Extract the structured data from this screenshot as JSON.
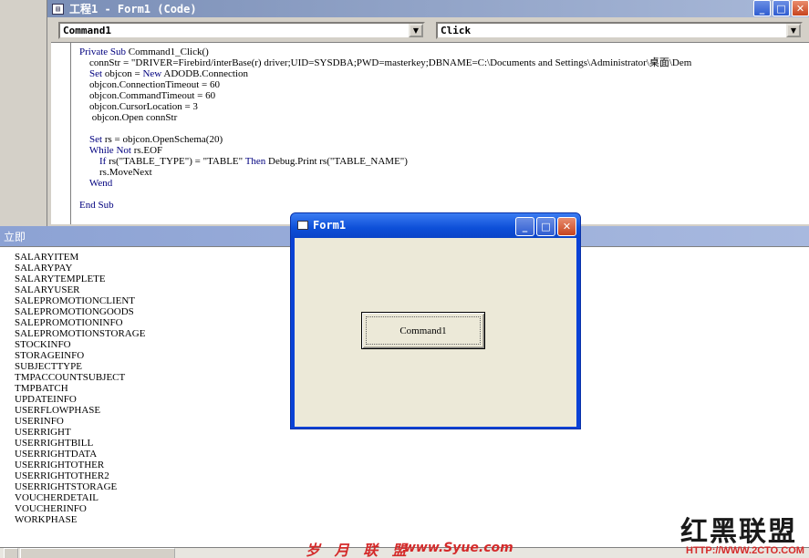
{
  "code_window": {
    "title": "工程1 - Form1 (Code)",
    "object_combo": "Command1",
    "proc_combo": "Click",
    "lines": [
      "Private Sub Command1_Click()",
      "    connStr = \"DRIVER=Firebird/interBase(r) driver;UID=SYSDBA;PWD=masterkey;DBNAME=C:\\Documents and Settings\\Administrator\\桌面\\Dem",
      "    Set objcon = New ADODB.Connection",
      "    objcon.ConnectionTimeout = 60",
      "    objcon.CommandTimeout = 60",
      "    objcon.CursorLocation = 3",
      "     objcon.Open connStr",
      "",
      "    Set rs = objcon.OpenSchema(20)",
      "    While Not rs.EOF",
      "        If rs(\"TABLE_TYPE\") = \"TABLE\" Then Debug.Print rs(\"TABLE_NAME\")",
      "        rs.MoveNext",
      "    Wend",
      "",
      "End Sub"
    ]
  },
  "immediate_window": {
    "title": "立即",
    "items": [
      "SALARYITEM",
      "SALARYPAY",
      "SALARYTEMPLETE",
      "SALARYUSER",
      "SALEPROMOTIONCLIENT",
      "SALEPROMOTIONGOODS",
      "SALEPROMOTIONINFO",
      "SALEPROMOTIONSTORAGE",
      "STOCKINFO",
      "STORAGEINFO",
      "SUBJECTTYPE",
      "TMPACCOUNTSUBJECT",
      "TMPBATCH",
      "UPDATEINFO",
      "USERFLOWPHASE",
      "USERINFO",
      "USERRIGHT",
      "USERRIGHTBILL",
      "USERRIGHTDATA",
      "USERRIGHTOTHER",
      "USERRIGHTOTHER2",
      "USERRIGHTSTORAGE",
      "VOUCHERDETAIL",
      "VOUCHERINFO",
      "WORKPHASE"
    ]
  },
  "form1": {
    "title": "Form1",
    "button_label": "Command1"
  },
  "icons": {
    "minimize": "minimize-icon",
    "maximize": "maximize-icon",
    "close": "close-icon",
    "dropdown": "chevron-down-icon"
  },
  "watermarks": {
    "syue_cn": "岁 月 联 盟",
    "syue_url": "www.Syue.com",
    "hongheilm": "红黑联盟",
    "cto_url": "HTTP://WWW.2CTO.COM"
  },
  "colors": {
    "titlebar_inactive": "#7b8fb7",
    "xp_blue": "#0a42d6",
    "keyword": "#00007f",
    "watermark_red": "#d42a2a"
  }
}
